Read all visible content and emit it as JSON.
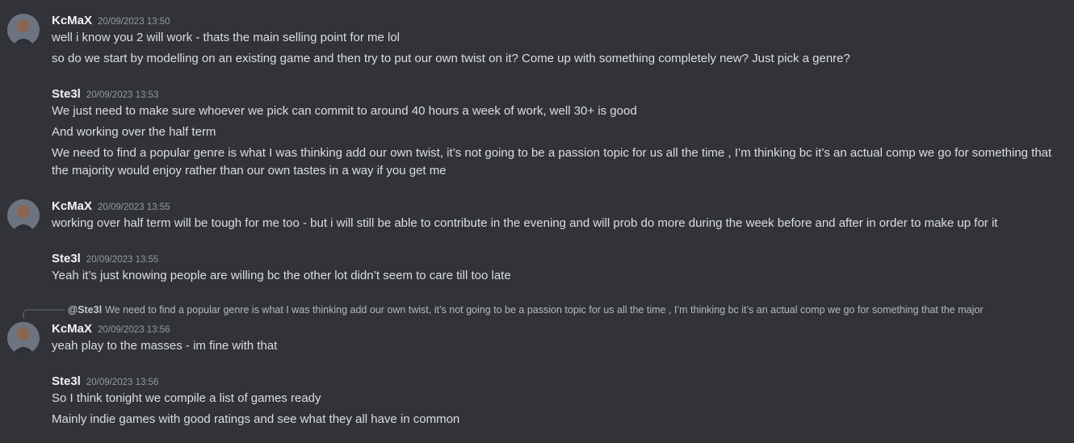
{
  "messages": [
    {
      "author": "KcMaX",
      "timestamp": "20/09/2023 13:50",
      "lines": [
        "well i know you 2 will work - thats the main selling point for me lol",
        "so do we start by modelling on an existing game and then try to put our own twist on it? Come up with something completely new? Just pick a genre?"
      ]
    },
    {
      "author": "Ste3l",
      "timestamp": "20/09/2023 13:53",
      "lines": [
        "We just need to make sure whoever we pick can commit to around 40 hours a week of work, well 30+ is good",
        "And working over the half term",
        "We need to find a popular genre is what I was thinking add our own twist, it’s not going to be a passion topic for us all the time , I’m thinking bc it’s an actual comp we go for something that the majority would enjoy rather than our own tastes in a way if you get me"
      ]
    },
    {
      "author": "KcMaX",
      "timestamp": "20/09/2023 13:55",
      "lines": [
        "working over half term will be tough for me too - but i will still be able to contribute in the evening and will prob do more during the week before and after in order to make up for it"
      ]
    },
    {
      "author": "Ste3l",
      "timestamp": "20/09/2023 13:55",
      "lines": [
        "Yeah it’s just knowing people are willing bc the other lot didn’t seem to care till too late"
      ]
    },
    {
      "reply": {
        "author": "@Ste3l",
        "text": "We need to find a popular genre is what I was thinking add our own twist, it’s not going to be a passion topic for us all the time , I’m thinking bc it’s an actual comp we go for something that the major"
      },
      "author": "KcMaX",
      "timestamp": "20/09/2023 13:56",
      "lines": [
        "yeah play to the masses - im fine with that"
      ]
    },
    {
      "author": "Ste3l",
      "timestamp": "20/09/2023 13:56",
      "lines": [
        "So I think tonight we compile a list of games ready",
        "Mainly indie games with good ratings and see what they all have in common"
      ]
    }
  ]
}
